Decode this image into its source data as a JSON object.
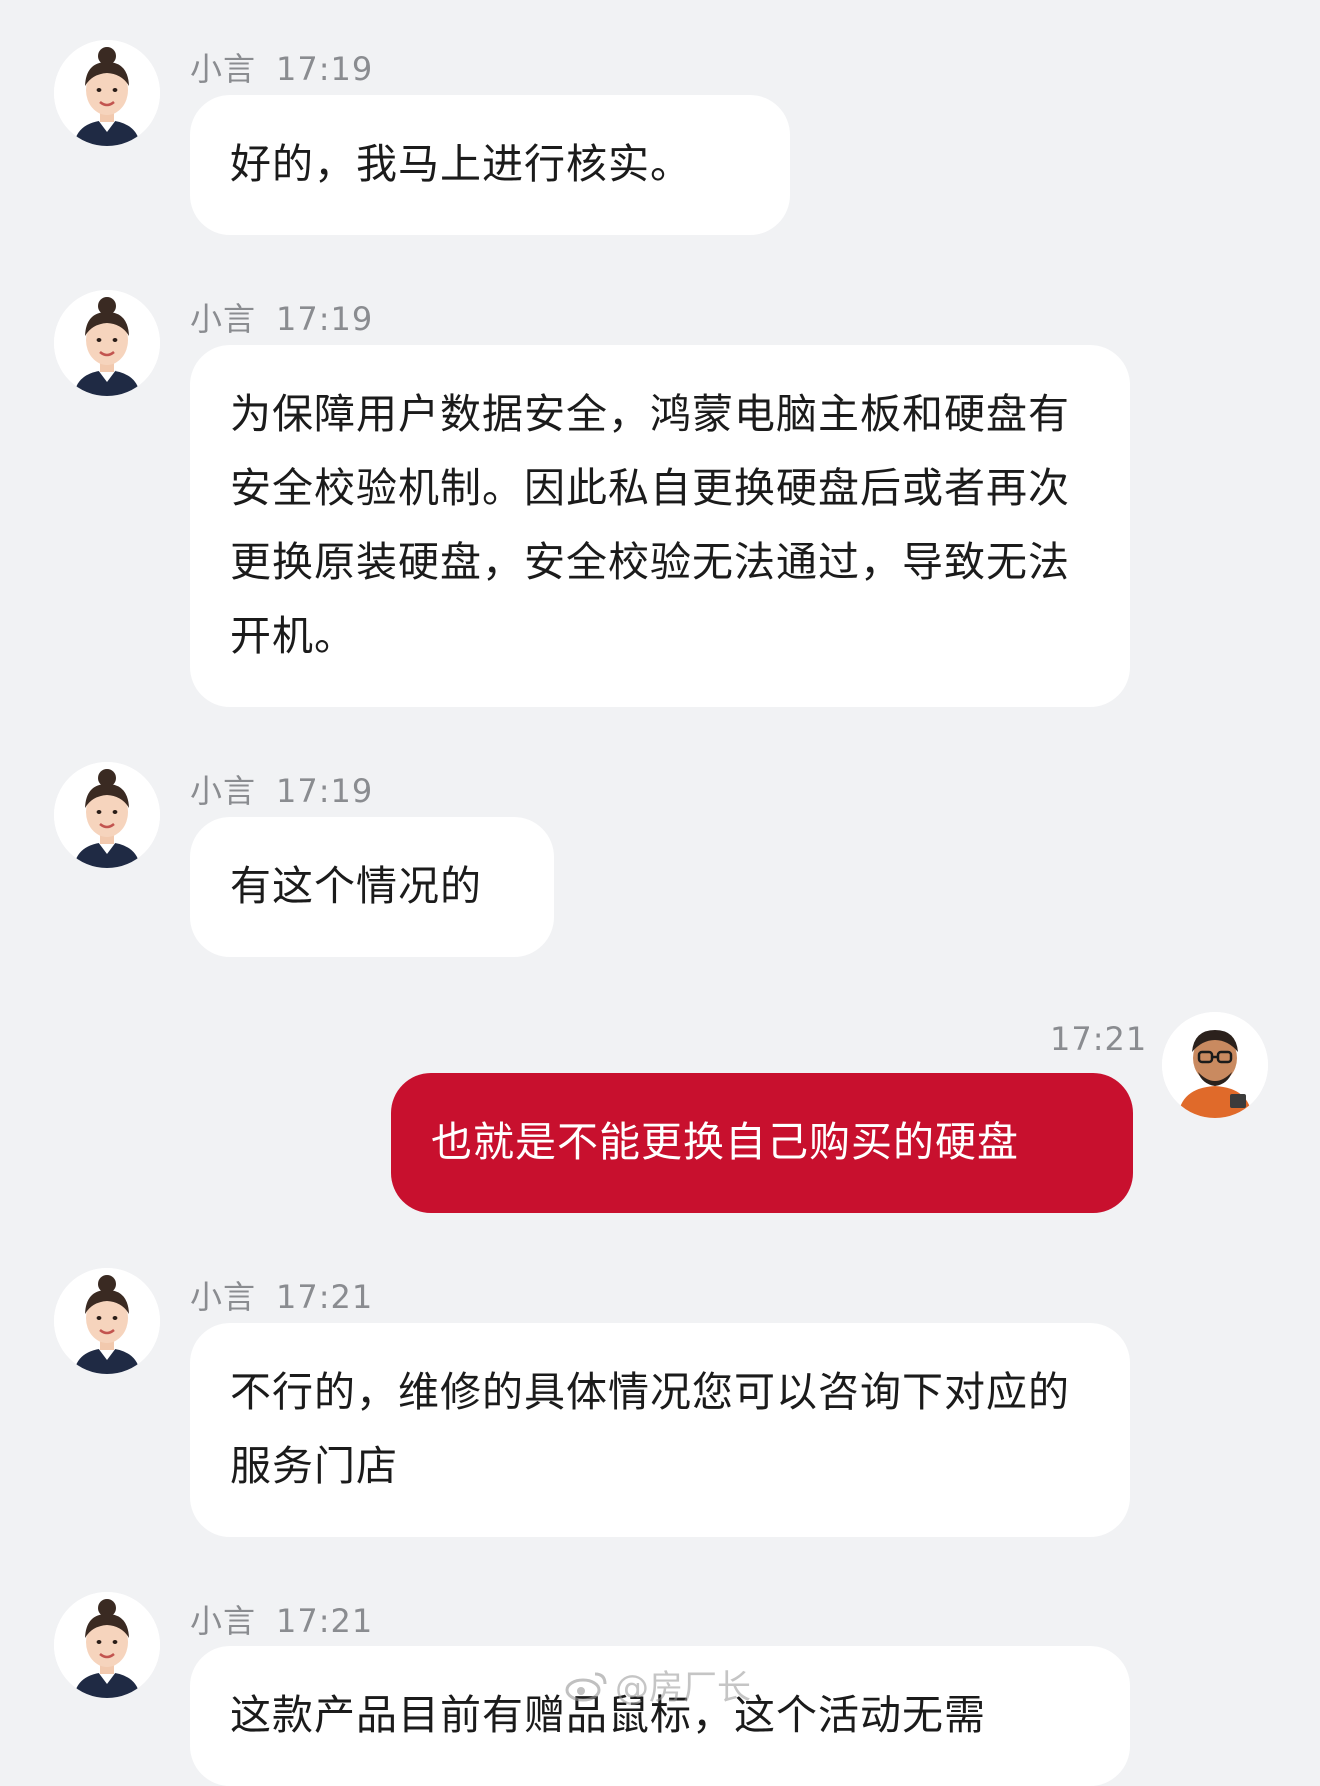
{
  "messages": [
    {
      "sender": "小言",
      "time": "17:19",
      "text": "好的，我马上进行核实。",
      "from_me": false
    },
    {
      "sender": "小言",
      "time": "17:19",
      "text": "为保障用户数据安全，鸿蒙电脑主板和硬盘有安全校验机制。因此私自更换硬盘后或者再次更换原装硬盘，安全校验无法通过，导致无法开机。",
      "from_me": false
    },
    {
      "sender": "小言",
      "time": "17:19",
      "text": "有这个情况的",
      "from_me": false
    },
    {
      "sender": "",
      "time": "17:21",
      "text": "也就是不能更换自己购买的硬盘",
      "from_me": true
    },
    {
      "sender": "小言",
      "time": "17:21",
      "text": "不行的，维修的具体情况您可以咨询下对应的服务门店",
      "from_me": false
    },
    {
      "sender": "小言",
      "time": "17:21",
      "text": "这款产品目前有赠品鼠标，这个活动无需",
      "from_me": false
    }
  ],
  "watermark": {
    "text": "@房厂长"
  },
  "icons": {
    "agent_avatar": "agent-avatar-woman",
    "user_avatar": "user-avatar-man-glasses",
    "watermark_icon": "weibo-icon"
  },
  "colors": {
    "background": "#f1f2f4",
    "my_bubble": "#c8102e",
    "their_bubble": "#ffffff"
  }
}
